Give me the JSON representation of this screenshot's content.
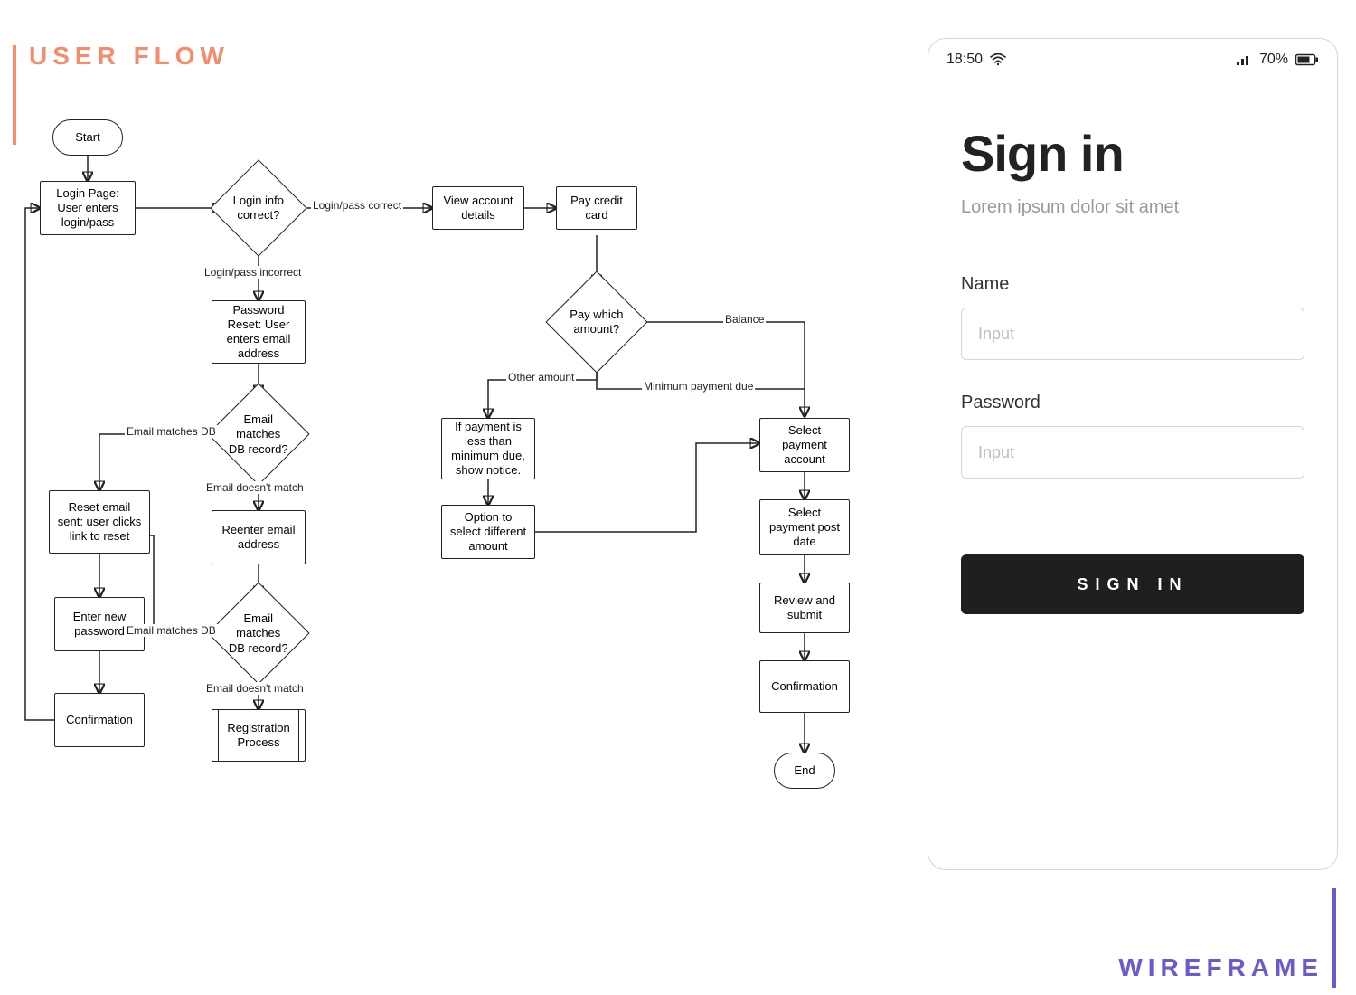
{
  "titles": {
    "user_flow": "USER FLOW",
    "wireframe": "WIREFRAME"
  },
  "flow": {
    "nodes": {
      "start": "Start",
      "login_page": "Login Page: User enters login/pass",
      "login_correct": "Login info correct?",
      "view_account": "View account details",
      "pay_card": "Pay credit card",
      "pay_which": "Pay which amount?",
      "notice": "If payment is less than minimum due, show notice.",
      "option_diff": "Option to select different amount",
      "select_acct": "Select payment account",
      "select_date": "Select payment post date",
      "review": "Review and submit",
      "confirm_pay": "Confirmation",
      "end": "End",
      "pwd_reset": "Password Reset: User enters email address",
      "email_match1": "Email matches DB record?",
      "reset_sent": "Reset email sent: user clicks link to reset",
      "reenter": "Reenter email address",
      "email_match2": "Email matches DB record?",
      "enter_new": "Enter new password",
      "confirm_reset": "Confirmation",
      "reg_process": "Registration Process"
    },
    "edges": {
      "login_correct_yes": "Login/pass correct",
      "login_correct_no": "Login/pass incorrect",
      "email_matches": "Email matches DB",
      "email_no_match": "Email doesn't match",
      "email_matches2": "Email matches DB",
      "email_no_match2": "Email doesn't match",
      "other_amount": "Other amount",
      "balance": "Balance",
      "min_due": "Minimum payment due"
    }
  },
  "wireframe": {
    "status": {
      "time": "18:50",
      "battery": "70%"
    },
    "title": "Sign in",
    "subtitle": "Lorem ipsum dolor sit amet",
    "name_label": "Name",
    "name_placeholder": "Input",
    "password_label": "Password",
    "password_placeholder": "Input",
    "button": "SIGN IN"
  }
}
